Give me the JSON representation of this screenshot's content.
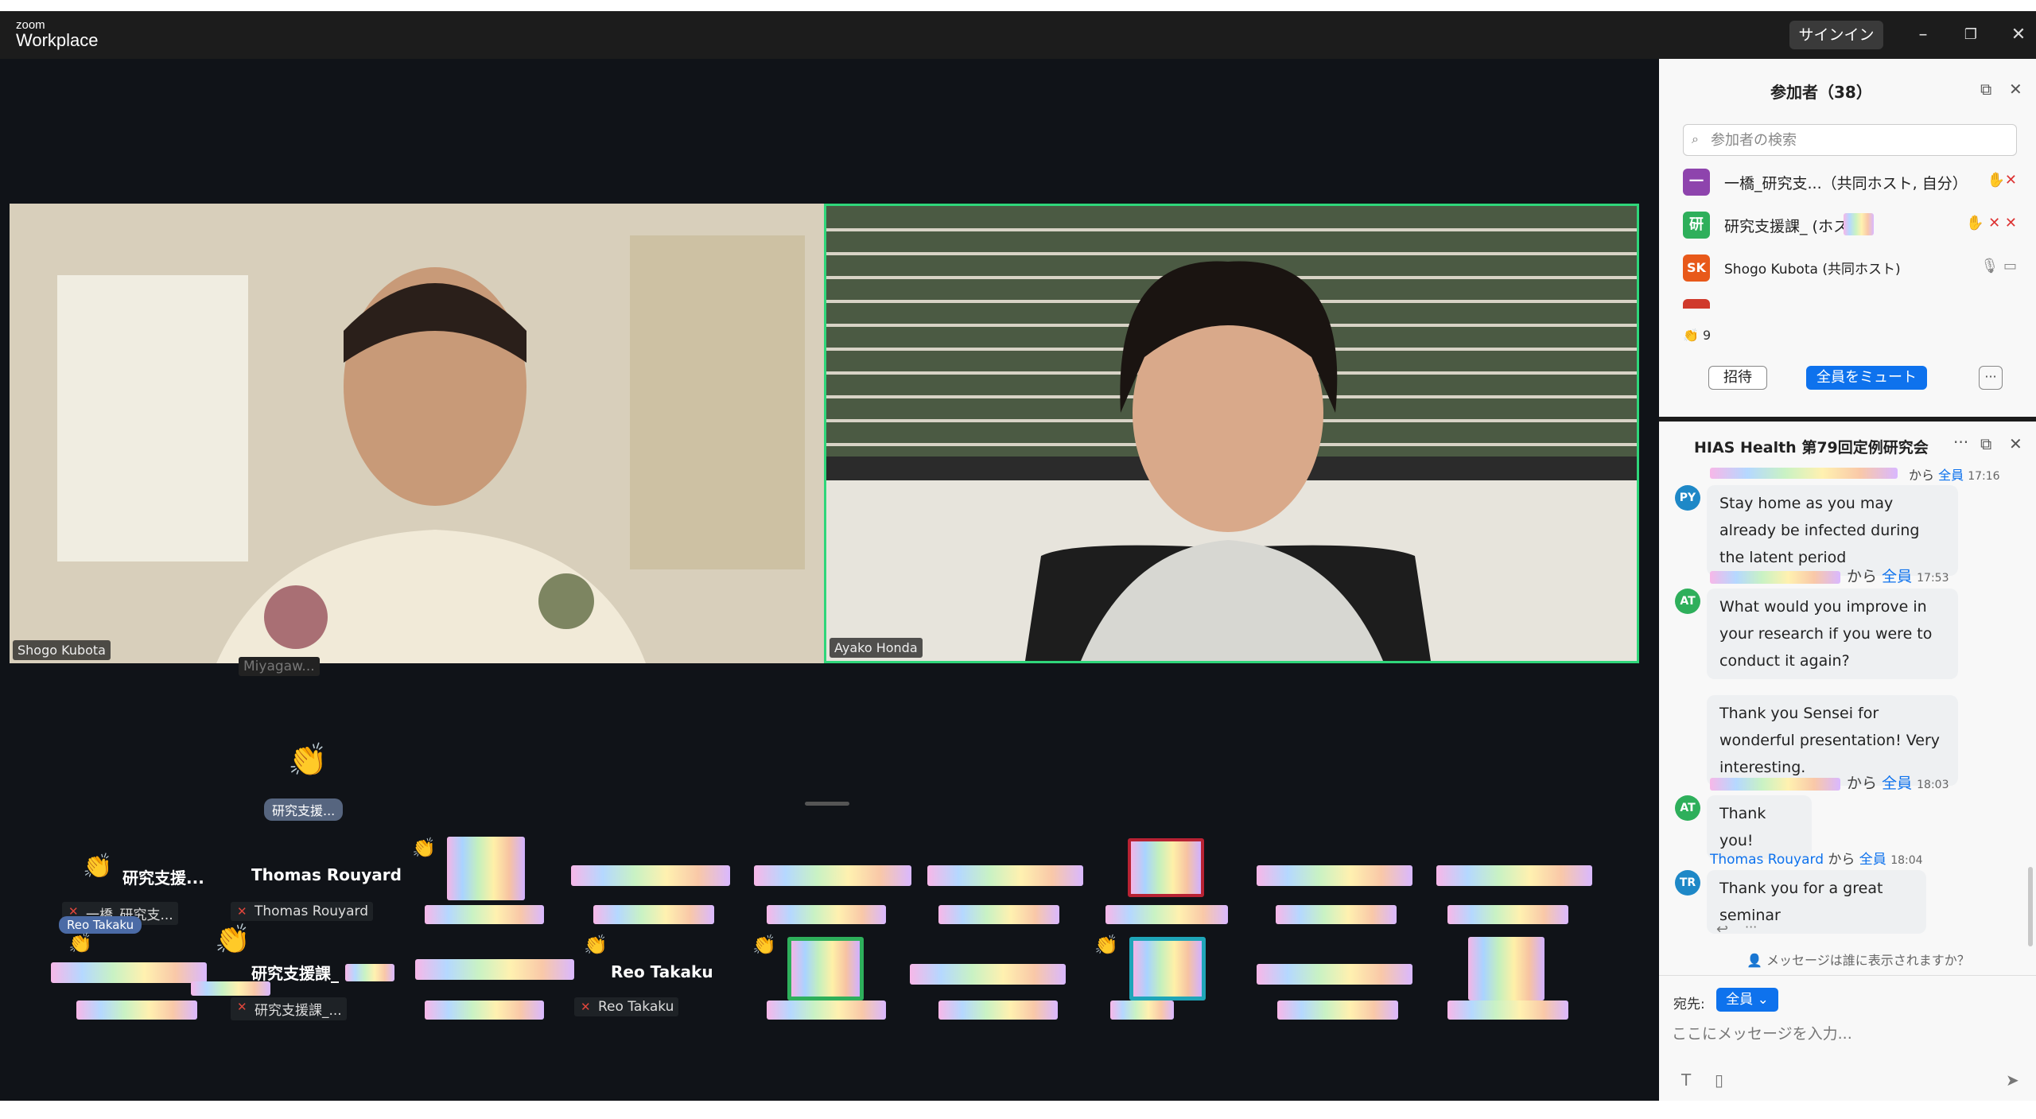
{
  "titlebar": {
    "logo_top": "zoom",
    "logo_bottom": "Workplace",
    "signin_label": "サインイン",
    "minimize_glyph": "–",
    "restore_glyph": "❐",
    "close_glyph": "✕"
  },
  "videos": {
    "left_name": "Shogo Kubota",
    "right_name": "Ayako Honda",
    "hidden_name": "Miyagaw..."
  },
  "gallery": {
    "reaction_pill": "研究支援...",
    "tile1_name": "研究支援...",
    "tile1_sub": "一橋_研究支...",
    "tile1_pill": "Reo Takaku",
    "tile2_name": "Thomas Rouyard",
    "tile2_sub": "Thomas Rouyard",
    "tile3_name": "研究支援課_",
    "tile3_sub": "研究支援課_...",
    "tile4_name": "Reo Takaku",
    "tile4_sub": "Reo Takaku",
    "mute_icon": "mic-muted-icon",
    "clap_icon": "clapping-hands-icon"
  },
  "participants": {
    "title": "参加者（38）",
    "search_placeholder": "参加者の検索",
    "rows": [
      {
        "initial": "一",
        "color": "#8e44ad",
        "name": "一橋_研究支...（共同ホスト, 自分）",
        "icons": "✋✕"
      },
      {
        "initial": "研",
        "color": "#2eaf5b",
        "name": "研究支援課_     (ホスト)",
        "icons": "✋ ✕ ✕"
      },
      {
        "initial": "SK",
        "color": "#e8591a",
        "name": "Shogo Kubota (共同ホスト)",
        "icons": "🎙 ▭"
      }
    ],
    "reaction_count": "9",
    "invite_label": "招待",
    "mute_all_label": "全員をミュート",
    "more_label": "···"
  },
  "chat": {
    "title": "HIAS Health 第79回定例研究会",
    "messages": [
      {
        "avatar": "PY",
        "color": "#1e88c7",
        "text": "Stay home as you may already be infected during the latent period"
      },
      {
        "avatar": "AT",
        "color": "#2eaf5b",
        "meta_from": "から",
        "meta_to": "全員",
        "meta_time": "17:53",
        "text": "What would you improve in your research if you were to conduct it again?"
      },
      {
        "text": "Thank you Sensei for wonderful presentation! Very interesting."
      },
      {
        "avatar": "AT",
        "color": "#2eaf5b",
        "meta_from": "から",
        "meta_to": "全員",
        "meta_time": "18:03",
        "text": "Thank you!"
      },
      {
        "avatar": "TR",
        "color": "#1e88c7",
        "meta_sender": "Thomas Rouyard",
        "meta_from": "から",
        "meta_to": "全員",
        "meta_time": "18:04",
        "text": "Thank you for a great seminar"
      }
    ],
    "top_meta_from": "から",
    "top_meta_to": "全員",
    "top_meta_time": "17:16",
    "visibility_note": "メッセージは誰に表示されますか？",
    "to_label": "宛先:",
    "to_value": "全員 ⌄",
    "input_placeholder": "ここにメッセージを入力..."
  }
}
